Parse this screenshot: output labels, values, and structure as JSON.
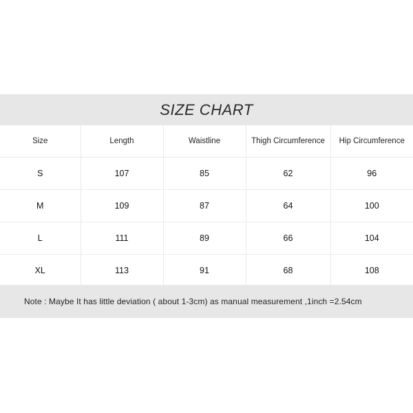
{
  "chart_data": {
    "type": "table",
    "title": "SIZE CHART",
    "columns": [
      "Size",
      "Length",
      "Waistline",
      "Thigh Circumference",
      "Hip Circumference"
    ],
    "rows": [
      [
        "S",
        "107",
        "85",
        "62",
        "96"
      ],
      [
        "M",
        "109",
        "87",
        "64",
        "100"
      ],
      [
        "L",
        "111",
        "89",
        "66",
        "104"
      ],
      [
        "XL",
        "113",
        "91",
        "68",
        "108"
      ]
    ],
    "note": "Note : Maybe It has little deviation ( about 1-3cm) as manual measurement ,1inch =2.54cm",
    "units": "cm",
    "legend": "",
    "xlabel": "",
    "ylabel": ""
  },
  "header": {
    "title": "SIZE CHART"
  },
  "table": {
    "headers": {
      "size": "Size",
      "length": "Length",
      "waistline": "Waistline",
      "thigh": "Thigh Circumference",
      "hip": "Hip Circumference"
    },
    "rows": [
      {
        "size": "S",
        "length": "107",
        "waistline": "85",
        "thigh": "62",
        "hip": "96"
      },
      {
        "size": "M",
        "length": "109",
        "waistline": "87",
        "thigh": "64",
        "hip": "100"
      },
      {
        "size": "L",
        "length": "111",
        "waistline": "89",
        "thigh": "66",
        "hip": "104"
      },
      {
        "size": "XL",
        "length": "113",
        "waistline": "91",
        "thigh": "68",
        "hip": "108"
      }
    ]
  },
  "footer": {
    "note": "Note : Maybe It has little deviation ( about 1-3cm) as manual measurement ,1inch =2.54cm"
  },
  "colors": {
    "band_background": "#e7e7e7",
    "page_background": "#ffffff",
    "grid_line": "#e9e9e9",
    "text": "#1f1f1f"
  }
}
